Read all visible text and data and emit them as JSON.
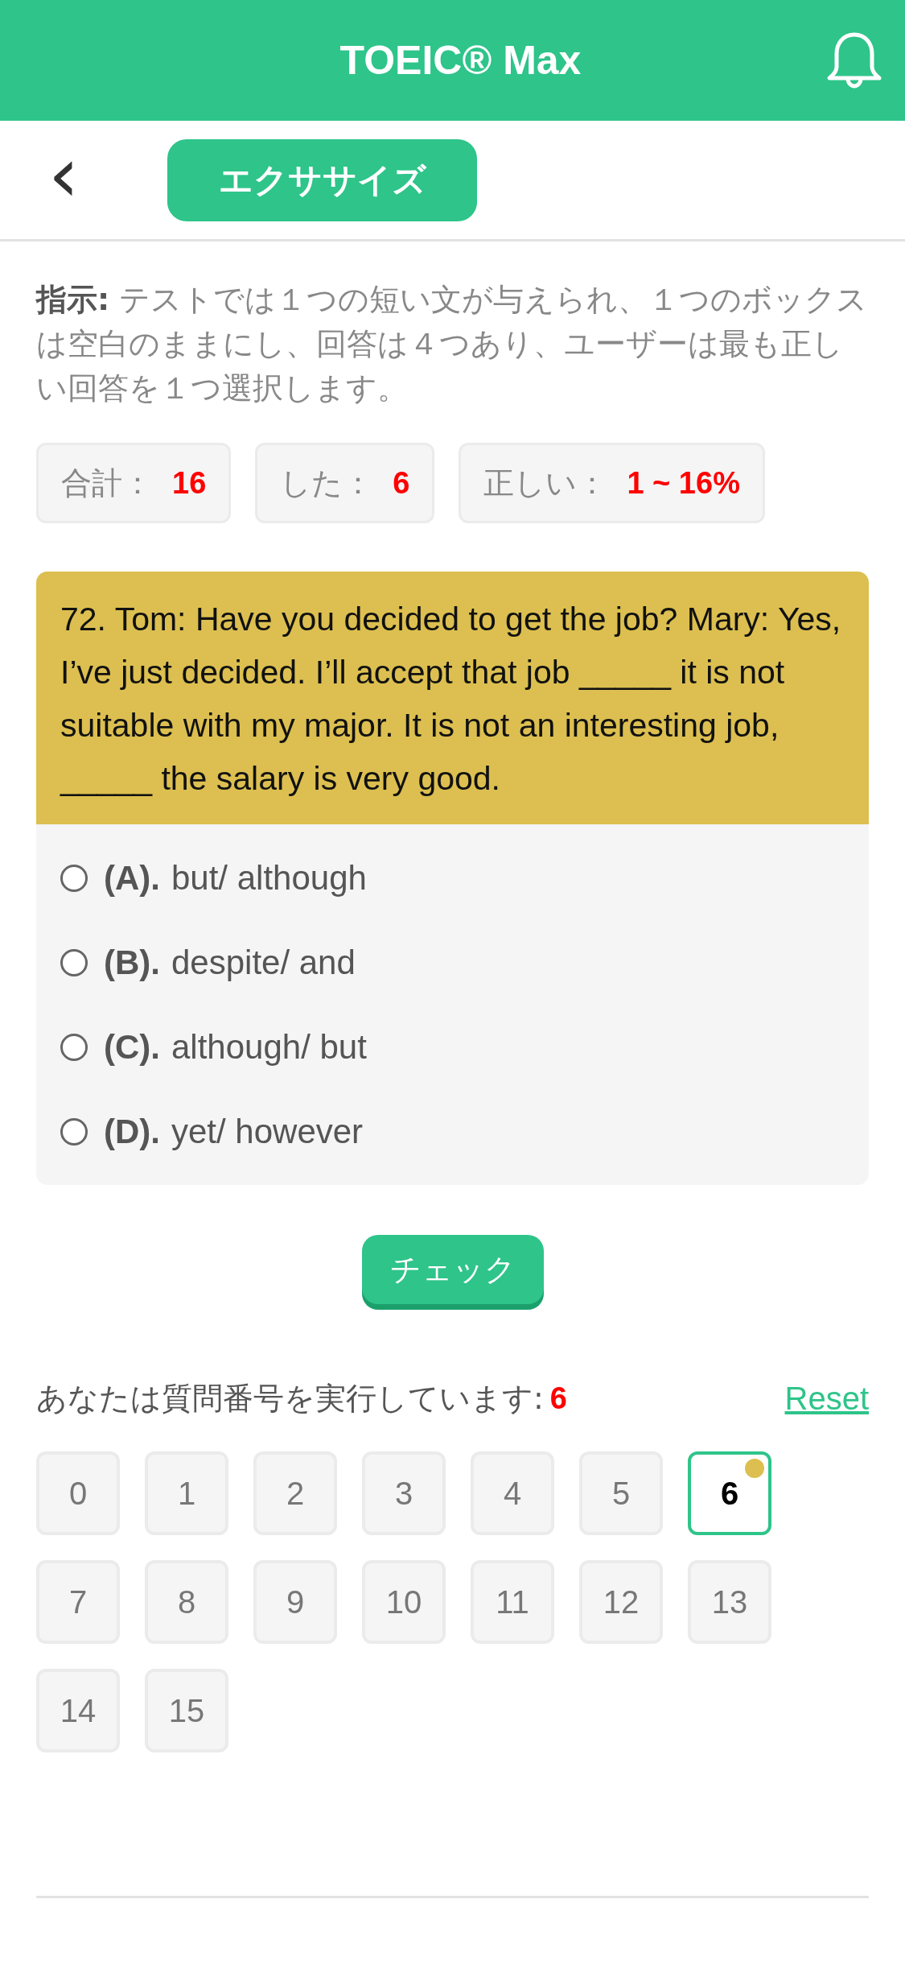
{
  "header": {
    "title": "TOEIC® Max"
  },
  "nav": {
    "back": "‹",
    "section": "エクササイズ"
  },
  "instruction": "**指示:** テストでは１つの短い文が与えられ、１つのボックスは空白のままにし、回答は４つあり、ユーザーは最も正しい回答を１つ選択します。",
  "stats": [
    {
      "label": "合計：",
      "value": "16"
    },
    {
      "label": "した：",
      "value": "6"
    },
    {
      "label": "正しい：",
      "value": "1 ~ 16%"
    }
  ],
  "question": {
    "text": "72. Tom: Have you decided to get the job? Mary: Yes, I’ve just decided. I’ll accept that job _____ it is not suitable with my major. It is not an interesting job, _____ the salary is very good.",
    "options": [
      {
        "letter": "(A).",
        "text": "but/ although",
        "checked": false
      },
      {
        "letter": "(B).",
        "text": "despite/ and",
        "checked": false
      },
      {
        "letter": "(C).",
        "text": "although/ but",
        "checked": false
      },
      {
        "letter": "(D).",
        "text": "yet/ however",
        "checked": false
      }
    ]
  },
  "check_button": "チェック",
  "progress": {
    "label": "あなたは質問番号を実行しています:",
    "current": "6",
    "reset": "Reset"
  },
  "numbers": [
    {
      "label": "0",
      "selected": false,
      "marked": false
    },
    {
      "label": "1",
      "selected": false,
      "marked": false
    },
    {
      "label": "2",
      "selected": false,
      "marked": false
    },
    {
      "label": "3",
      "selected": false,
      "marked": false
    },
    {
      "label": "4",
      "selected": false,
      "marked": false
    },
    {
      "label": "5",
      "selected": false,
      "marked": false
    },
    {
      "label": "6",
      "selected": true,
      "marked": true
    },
    {
      "label": "7",
      "selected": false,
      "marked": false
    },
    {
      "label": "8",
      "selected": false,
      "marked": false
    },
    {
      "label": "9",
      "selected": false,
      "marked": false
    },
    {
      "label": "10",
      "selected": false,
      "marked": false
    },
    {
      "label": "11",
      "selected": false,
      "marked": false
    },
    {
      "label": "12",
      "selected": false,
      "marked": false
    },
    {
      "label": "13",
      "selected": false,
      "marked": false
    },
    {
      "label": "14",
      "selected": false,
      "marked": false
    },
    {
      "label": "15",
      "selected": false,
      "marked": false
    }
  ]
}
